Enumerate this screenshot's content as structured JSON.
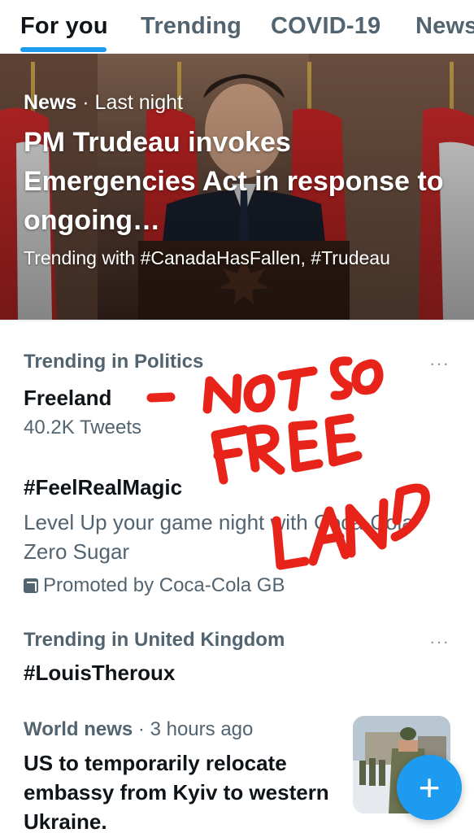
{
  "tabs": [
    {
      "label": "For you",
      "active": true
    },
    {
      "label": "Trending",
      "active": false
    },
    {
      "label": "COVID-19",
      "active": false
    },
    {
      "label": "News",
      "active": false
    }
  ],
  "hero": {
    "category": "News",
    "separator": "·",
    "time": "Last night",
    "title": "PM Trudeau invokes Emergencies Act in response to ongoing…",
    "subtitle": "Trending with #CanadaHasFallen, #Trudeau"
  },
  "trends": [
    {
      "context": "Trending in Politics",
      "title": "Freeland",
      "count": "40.2K Tweets",
      "more": "···"
    },
    {
      "title": "#FeelRealMagic",
      "description": "Level Up your game night with Coca-Cola Zero Sugar",
      "promoted": "Promoted by Coca-Cola GB"
    },
    {
      "context": "Trending in United Kingdom",
      "title": "#LouisTheroux",
      "more": "···"
    }
  ],
  "news": {
    "category": "World news",
    "separator": "·",
    "time": "3 hours ago",
    "title": "US to temporarily relocate embassy from Kyiv to western Ukraine."
  },
  "handwriting": {
    "dash": "-",
    "text": "NOT SO FREE LAND",
    "color": "#e8231a"
  },
  "fab": {
    "icon": "plus-icon",
    "label": "+"
  },
  "colors": {
    "accent": "#1d9bf0",
    "secondary_text": "#536471",
    "primary_text": "#0f1419"
  }
}
